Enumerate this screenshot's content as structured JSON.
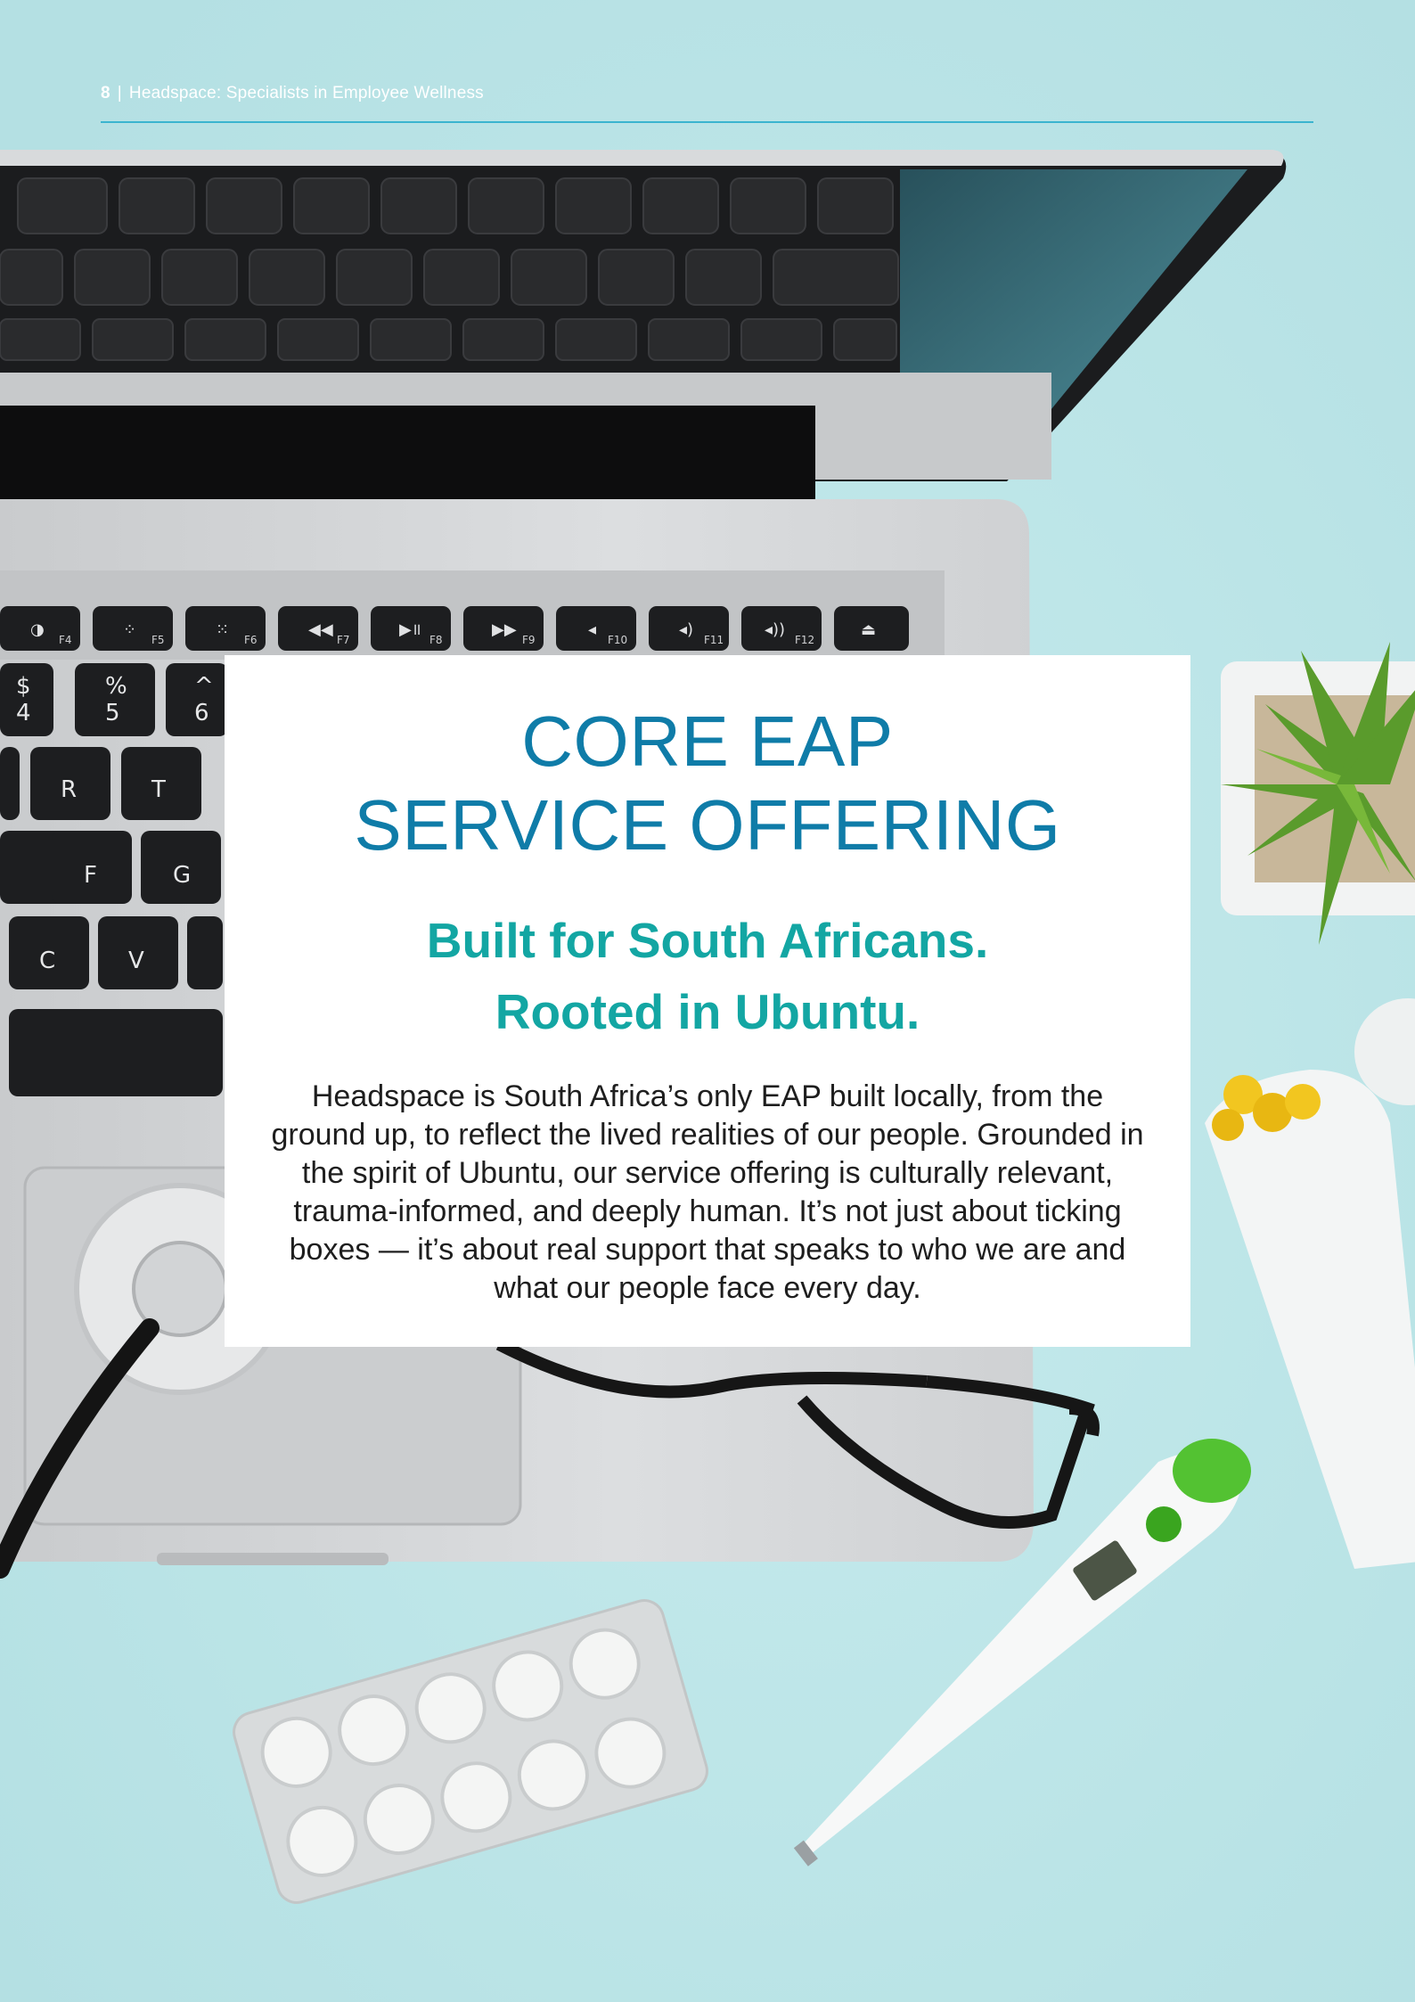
{
  "header": {
    "page_number": "8",
    "separator": "|",
    "running_title": "Headspace: Specialists in Employee Wellness"
  },
  "card": {
    "title_lines": [
      "CORE EAP",
      "SERVICE OFFERING"
    ],
    "subtitle_lines": [
      "Built for South Africans.",
      "Rooted in Ubuntu."
    ],
    "body": "Headspace is South Africa’s only EAP built locally, from the ground up, to reflect the lived realities of our people. Grounded in the spirit of Ubuntu, our service offering is culturally relevant, trauma-informed, and deeply human. It’s not just about ticking boxes — it’s about real support that speaks to who we are and what our people face every day."
  },
  "keyboard": {
    "function_row": [
      "F4",
      "F5",
      "F6",
      "F7",
      "F8",
      "F9",
      "F10",
      "F11",
      "F12"
    ],
    "number_row": [
      {
        "top": "$",
        "bottom": "4"
      },
      {
        "top": "%",
        "bottom": "5"
      },
      {
        "top": "^",
        "bottom": "6"
      }
    ],
    "letter_rows": [
      [
        "R",
        "T"
      ],
      [
        "F",
        "G"
      ],
      [
        "C",
        "V"
      ]
    ]
  },
  "colors": {
    "background": "#bfe6e8",
    "title": "#0f7ca8",
    "subtitle": "#13a6a3",
    "rule": "#3bb4cf",
    "body_text": "#1e1e1e"
  }
}
